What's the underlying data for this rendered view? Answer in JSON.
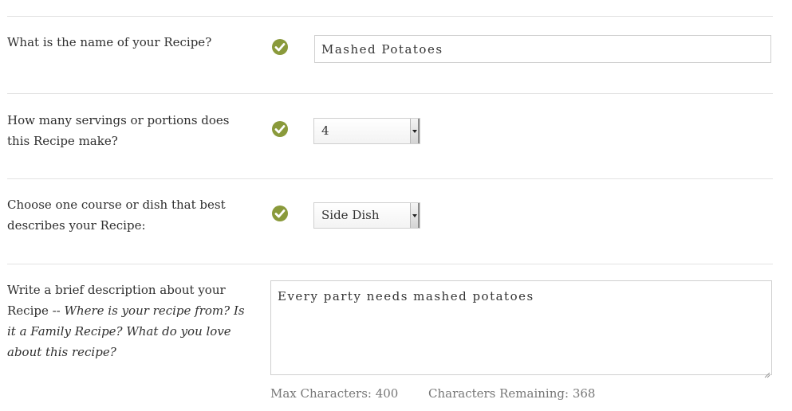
{
  "form": {
    "name": {
      "question": "What is the name of your Recipe?",
      "value": "Mashed Potatoes",
      "valid": true
    },
    "servings": {
      "question": "How many servings or portions does this Recipe make?",
      "selected": "4",
      "valid": true
    },
    "course": {
      "question": "Choose one course or dish that best describes your Recipe:",
      "selected": "Side Dish",
      "valid": true
    },
    "description": {
      "question_plain": "Write a brief description about your Recipe -- ",
      "question_italic": "Where is your recipe from? Is it a Family Recipe? What do you love about this recipe?",
      "value": "Every party needs mashed potatoes",
      "max_characters_label": "Max Characters: 400",
      "characters_remaining_label": "Characters Remaining: 368"
    }
  },
  "colors": {
    "check_green": "#8a9a3b",
    "divider": "#e2e2e2",
    "text": "#2f2f2f",
    "muted_text": "#777777"
  },
  "icons": {
    "valid_indicator": "check-circle-icon",
    "select_arrow": "chevron-down-icon",
    "resize_handle": "resize-grip-icon"
  }
}
